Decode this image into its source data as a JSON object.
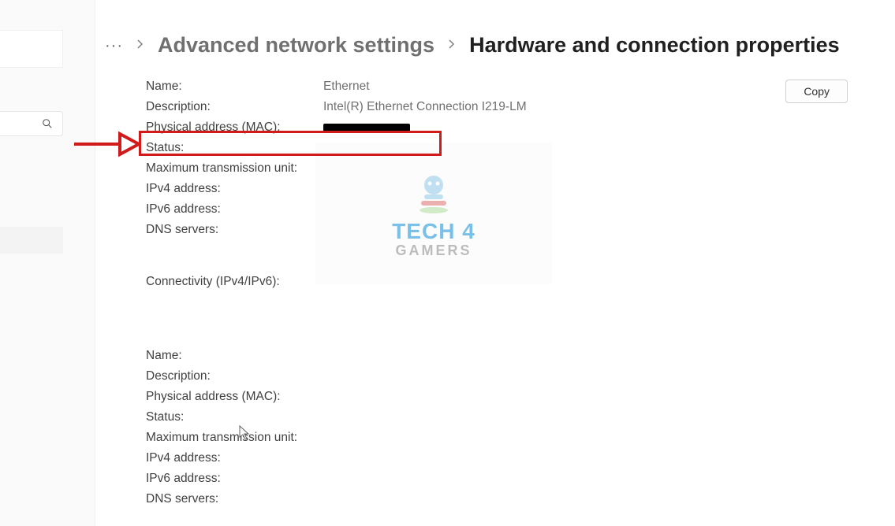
{
  "window": {
    "minimize": "—",
    "maximize": "▢",
    "close": "✕"
  },
  "breadcrumb": {
    "dots": "···",
    "level1": "Advanced network settings",
    "current": "Hardware and connection properties"
  },
  "copy_button": "Copy",
  "block1": {
    "name_label": "Name:",
    "name_value": "Ethernet",
    "description_label": "Description:",
    "description_value": "Intel(R) Ethernet Connection I219-LM",
    "mac_label": "Physical address (MAC):",
    "status_label": "Status:",
    "mtu_label": "Maximum transmission unit:",
    "ipv4_label": "IPv4 address:",
    "ipv6_label": "IPv6 address:",
    "dns_label": "DNS servers:",
    "connectivity_label": "Connectivity (IPv4/IPv6):"
  },
  "block2": {
    "name_label": "Name:",
    "description_label": "Description:",
    "mac_label": "Physical address (MAC):",
    "status_label": "Status:",
    "mtu_label": "Maximum transmission unit:",
    "ipv4_label": "IPv4 address:",
    "ipv6_label": "IPv6 address:",
    "dns_label": "DNS servers:"
  },
  "watermark": {
    "line1": "TECH 4",
    "line2": "GAMERS"
  }
}
